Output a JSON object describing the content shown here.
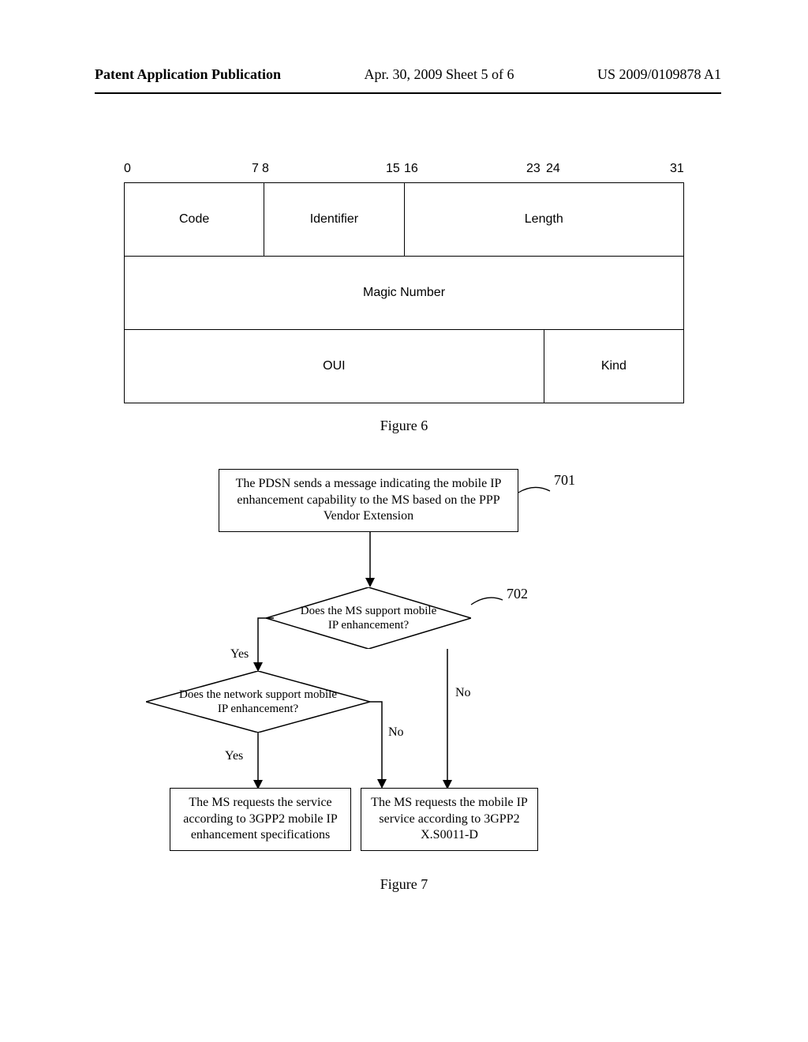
{
  "header": {
    "publication_label": "Patent Application Publication",
    "date_sheet": "Apr. 30, 2009  Sheet 5 of 6",
    "publication_number": "US 2009/0109878 A1"
  },
  "fig6": {
    "bit_labels": {
      "b0": "0",
      "b7": "7",
      "b8": "8",
      "b15": "15",
      "b16": "16",
      "b23": "23",
      "b24": "24",
      "b31": "31"
    },
    "row1": {
      "code": "Code",
      "identifier": "Identifier",
      "length": "Length"
    },
    "row2": {
      "magic": "Magic Number"
    },
    "row3": {
      "oui": "OUI",
      "kind": "Kind"
    },
    "caption": "Figure 6"
  },
  "fig7": {
    "step701": "The PDSN sends a message indicating the mobile IP enhancement capability to the MS based on the PPP Vendor Extension",
    "callout701": "701",
    "diamond702": "Does the MS support mobile IP enhancement?",
    "callout702": "702",
    "diamond2": "Does the network support mobile IP enhancement?",
    "yes1": "Yes",
    "yes2": "Yes",
    "no1": "No",
    "no2": "No",
    "box_left": "The MS requests the service according to 3GPP2 mobile IP enhancement specifications",
    "box_right": "The MS requests the mobile IP service according to 3GPP2 X.S0011-D",
    "caption": "Figure 7"
  }
}
